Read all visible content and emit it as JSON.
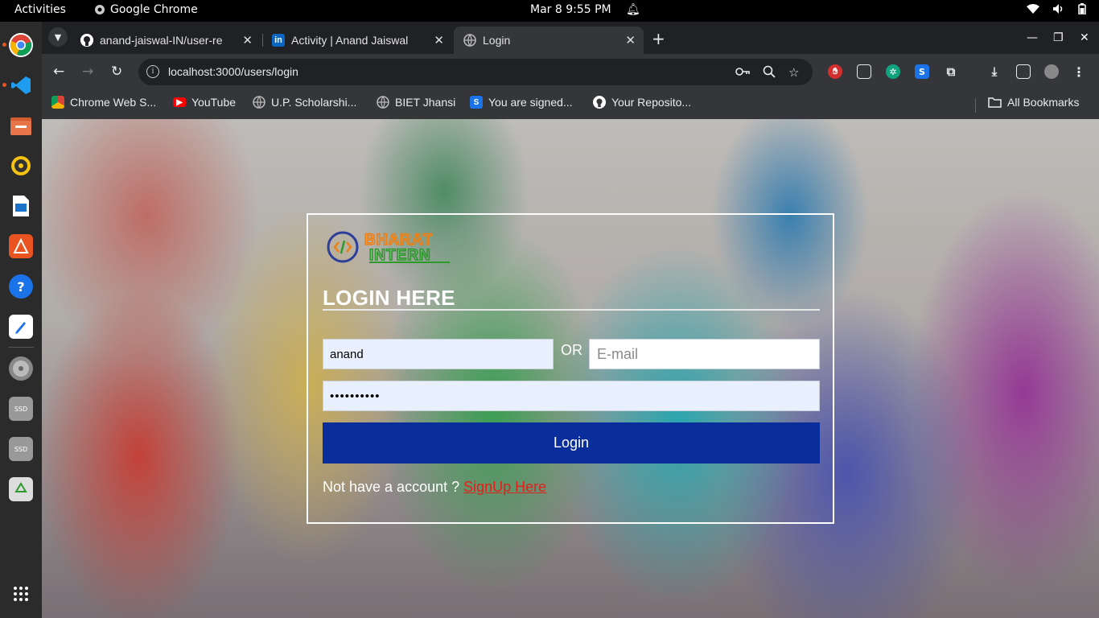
{
  "system": {
    "activities": "Activities",
    "app_name": "Google Chrome",
    "clock": "Mar 8   9:55 PM"
  },
  "tabs": [
    {
      "label": "anand-jaiswal-IN/user-re",
      "icon": "github-icon"
    },
    {
      "label": "Activity | Anand Jaiswal",
      "icon": "linkedin-icon"
    },
    {
      "label": "Login",
      "icon": "globe-icon",
      "active": true
    }
  ],
  "address_bar": {
    "url": "localhost:3000/users/login"
  },
  "bookmarks": [
    {
      "label": "Chrome Web S...",
      "icon": "chrome-web-store-icon"
    },
    {
      "label": "YouTube",
      "icon": "youtube-icon"
    },
    {
      "label": "U.P. Scholarshi...",
      "icon": "globe-icon"
    },
    {
      "label": "BIET Jhansi",
      "icon": "globe-icon"
    },
    {
      "label": "You are signed...",
      "icon": "s-icon"
    },
    {
      "label": "Your Reposito...",
      "icon": "github-icon"
    }
  ],
  "all_bookmarks": "All Bookmarks",
  "login": {
    "logo_line1": "BHARAT",
    "logo_line2": "INTERN",
    "title": "LOGIN HERE",
    "username_value": "anand",
    "or_text": "OR",
    "email_placeholder": "E-mail",
    "password_value": "••••••••••",
    "button_label": "Login",
    "signup_prompt": "Not have a account ? ",
    "signup_link": "SignUp Here"
  },
  "colors": {
    "login_button": "#0a2d9c",
    "signup_link": "#e0201a",
    "logo_orange": "#f07f10",
    "logo_green": "#2e9a2e"
  }
}
